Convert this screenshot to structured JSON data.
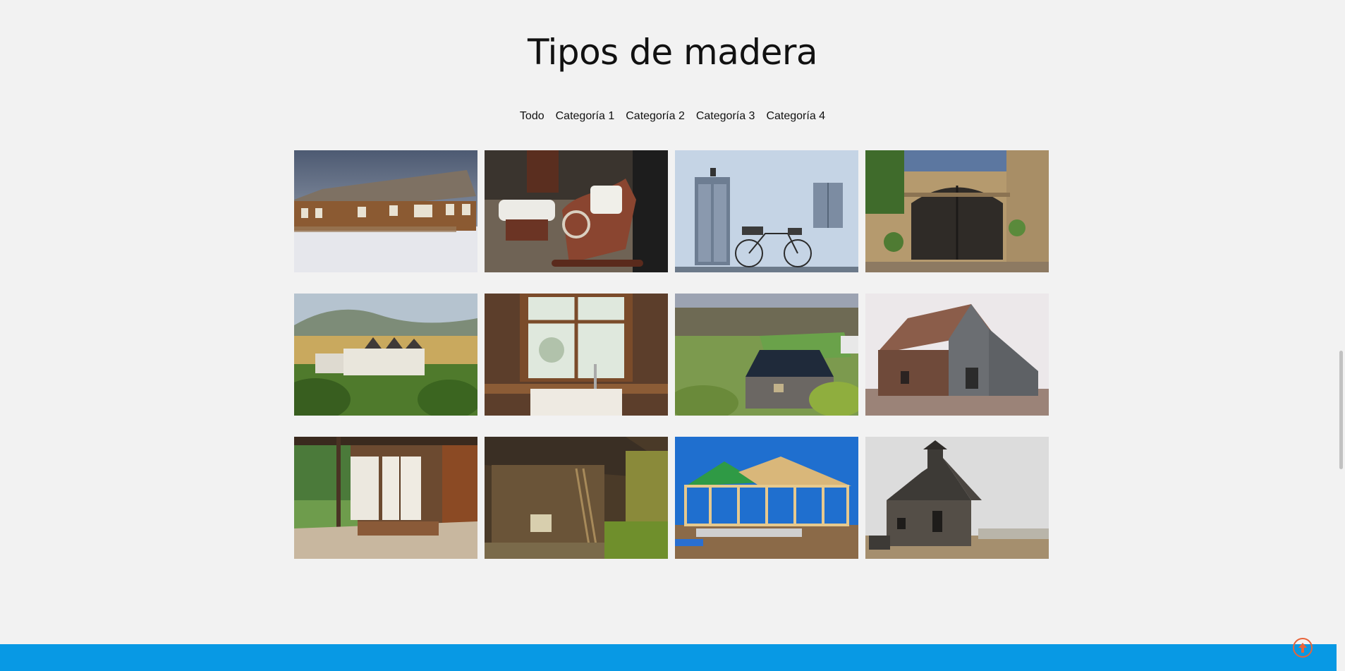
{
  "gallery": {
    "title": "Tipos de madera",
    "filters": [
      "Todo",
      "Categoría 1",
      "Categoría 2",
      "Categoría 3",
      "Categoría 4"
    ],
    "images": [
      {
        "subject": "log-house-in-snow"
      },
      {
        "subject": "wooden-rocking-chair"
      },
      {
        "subject": "door-and-bicycle"
      },
      {
        "subject": "wooden-arched-gate"
      },
      {
        "subject": "country-house-hills"
      },
      {
        "subject": "wooden-window-kitchen"
      },
      {
        "subject": "stone-cottage-field"
      },
      {
        "subject": "old-wooden-barn"
      },
      {
        "subject": "japanese-house-pond"
      },
      {
        "subject": "rustic-wooden-cabin"
      },
      {
        "subject": "house-frame-construction"
      },
      {
        "subject": "abandoned-barn"
      }
    ]
  },
  "colors": {
    "background": "#f2f2f2",
    "footer": "#0899e4",
    "to_top_icon": "#e8643a"
  },
  "icons": {
    "to_top": "arrow-up-circle-icon"
  }
}
